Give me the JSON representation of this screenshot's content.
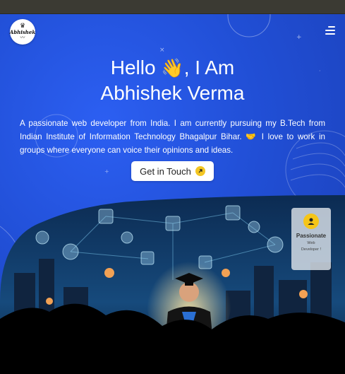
{
  "logo": {
    "text": "Abhishek",
    "crown": "♛",
    "mustache": "〰"
  },
  "nav": {
    "menu_icon": "hamburger-menu-icon"
  },
  "hero": {
    "greeting_line1": "Hello",
    "wave_emoji": "👋",
    "greeting_line1_end": ", I Am",
    "name": "Abhishek Verma",
    "intro": "A passionate web developer from India. I am currently pursuing my B.Tech from Indian Institute of Information Technology Bhagalpur Bihar. 🤝 I love to work in groups where everyone can voice their opinions and ideas.",
    "cta_label": "Get in Touch",
    "cta_icon": "arrow-up-right-icon"
  },
  "badge": {
    "title": "Passionate",
    "line2": "Web",
    "line3": "Developer !",
    "icon": "user-icon"
  },
  "colors": {
    "hero_bg": "#214fd6",
    "topbar": "#3b3a33",
    "accent_yellow": "#f3c623",
    "text": "#ffffff"
  }
}
